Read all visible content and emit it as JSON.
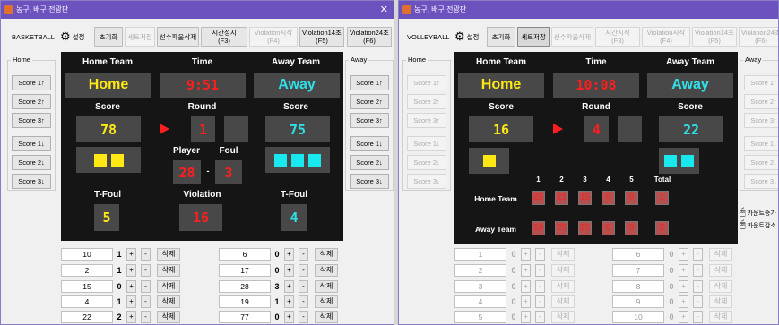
{
  "left": {
    "title": "농구, 배구 전광판",
    "sport_label": "BASKETBALL",
    "toolbar": {
      "settings": "설정",
      "reset": "초기화",
      "save_set": "세트저장",
      "delete_player": "선수파울삭제",
      "time_stop_l1": "시간정지",
      "time_stop_l2": "(F3)",
      "viol_start_l1": "Violation시작",
      "viol_start_l2": "(F4)",
      "viol14_l1": "Violation14초",
      "viol14_l2": "(F5)",
      "viol24_l1": "Violation24초",
      "viol24_l2": "(F6)"
    },
    "home_group": "Home",
    "away_group": "Away",
    "home_buttons": [
      "Score 1↑",
      "Score 2↑",
      "Score 3↑",
      "Score 1↓",
      "Score 2↓",
      "Score 3↓"
    ],
    "away_buttons": [
      "Score 1↑",
      "Score 2↑",
      "Score 3↑",
      "Score 1↓",
      "Score 2↓",
      "Score 3↓"
    ],
    "board": {
      "home_team_label": "Home Team",
      "time_label": "Time",
      "away_team_label": "Away Team",
      "home_name": "Home",
      "time": "9:51",
      "away_name": "Away",
      "score_label_l": "Score",
      "round_label": "Round",
      "score_label_r": "Score",
      "home_score": "78",
      "round": "1",
      "away_score": "75",
      "player_label": "Player",
      "foul_label": "Foul",
      "player": "28",
      "dash": "-",
      "foul": "3",
      "home_fouls": 2,
      "away_fouls": 3,
      "tfoul_label_l": "T-Foul",
      "violation_label": "Violation",
      "tfoul_label_r": "T-Foul",
      "home_tfoul": "5",
      "violation": "16",
      "away_tfoul": "4"
    },
    "plus": "+",
    "minus": "-",
    "delete": "삭제",
    "home_players": [
      {
        "no": "10",
        "fouls": "1"
      },
      {
        "no": "2",
        "fouls": "1"
      },
      {
        "no": "15",
        "fouls": "0"
      },
      {
        "no": "4",
        "fouls": "1"
      },
      {
        "no": "22",
        "fouls": "2"
      }
    ],
    "away_players": [
      {
        "no": "6",
        "fouls": "0"
      },
      {
        "no": "17",
        "fouls": "0"
      },
      {
        "no": "28",
        "fouls": "3"
      },
      {
        "no": "19",
        "fouls": "1"
      },
      {
        "no": "77",
        "fouls": "0"
      }
    ]
  },
  "right": {
    "title": "농구, 배구 전광판",
    "sport_label": "VOLLEYBALL",
    "toolbar": {
      "settings": "설정",
      "reset": "초기화",
      "save_set": "세트저장",
      "delete_player": "선수파울삭제",
      "time_start_l1": "시간시작",
      "time_start_l2": "(F3)",
      "viol_start_l1": "Violation시작",
      "viol_start_l2": "(F4)",
      "viol14_l1": "Violation14초",
      "viol14_l2": "(F5)",
      "viol24_l1": "Violation24초",
      "viol24_l2": "(F6)"
    },
    "home_group": "Home",
    "away_group": "Away",
    "home_buttons": [
      "Score 1↑",
      "Score 2↑",
      "Score 3↑",
      "Score 1↓",
      "Score 2↓",
      "Score 3↓"
    ],
    "away_buttons": [
      "Score 1↑",
      "Score 2↑",
      "Score 3↑",
      "Score 1↓",
      "Score 2↓",
      "Score 3↓"
    ],
    "board": {
      "home_team_label": "Home Team",
      "time_label": "Time",
      "away_team_label": "Away Team",
      "home_name": "Home",
      "time": "10:08",
      "away_name": "Away",
      "score_label_l": "Score",
      "round_label": "Round",
      "score_label_r": "Score",
      "home_score": "16",
      "round": "4",
      "away_score": "22",
      "home_sets_won": 1,
      "away_sets_won": 2,
      "set_headers": [
        "1",
        "2",
        "3",
        "4",
        "5",
        "Total"
      ],
      "home_row_label": "Home Team",
      "away_row_label": "Away Team",
      "home_sets": [
        "25",
        "21",
        "15",
        "0",
        "0",
        "1"
      ],
      "away_sets": [
        "19",
        "25",
        "25",
        "0",
        "0",
        "2"
      ]
    },
    "counter_up": "카운트증가",
    "counter_down": "카운트감소",
    "plus": "+",
    "minus": "-",
    "delete": "삭제",
    "home_players": [
      {
        "no": "1",
        "fouls": "0"
      },
      {
        "no": "2",
        "fouls": "0"
      },
      {
        "no": "3",
        "fouls": "0"
      },
      {
        "no": "4",
        "fouls": "0"
      },
      {
        "no": "5",
        "fouls": "0"
      }
    ],
    "away_players": [
      {
        "no": "6",
        "fouls": "0"
      },
      {
        "no": "7",
        "fouls": "0"
      },
      {
        "no": "8",
        "fouls": "0"
      },
      {
        "no": "9",
        "fouls": "0"
      },
      {
        "no": "10",
        "fouls": "0"
      }
    ]
  }
}
